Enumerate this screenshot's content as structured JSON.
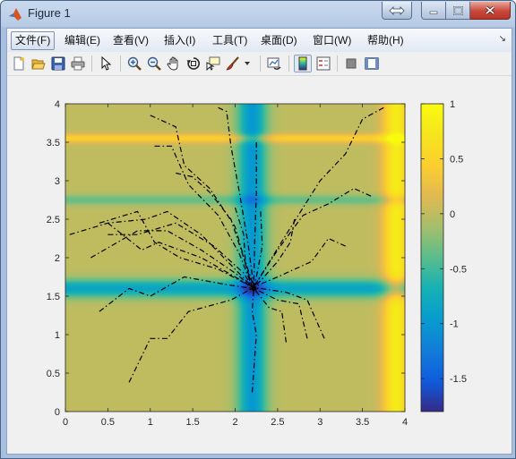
{
  "window": {
    "title": "Figure 1"
  },
  "menu": {
    "items": [
      "文件(F)",
      "编辑(E)",
      "查看(V)",
      "插入(I)",
      "工具(T)",
      "桌面(D)",
      "窗口(W)",
      "帮助(H)"
    ],
    "active_index": 0
  },
  "toolbar": {
    "icons": [
      "new-figure-icon",
      "open-file-icon",
      "save-icon",
      "print-icon",
      "edit-plot-arrow-icon",
      "zoom-in-icon",
      "zoom-out-icon",
      "pan-hand-icon",
      "rotate-3d-icon",
      "data-cursor-icon",
      "brush-icon",
      "link-plot-icon",
      "colorbar-icon",
      "legend-icon",
      "hide-plot-tools-icon",
      "show-plot-tools-icon"
    ]
  },
  "chart_data": {
    "type": "heatmap",
    "overlay": "dash-dot descent paths converging to a minimum",
    "xlim": [
      0,
      4
    ],
    "ylim": [
      0,
      4
    ],
    "x_ticks": [
      "0",
      "0.5",
      "1",
      "1.5",
      "2",
      "2.5",
      "3",
      "3.5",
      "4"
    ],
    "y_ticks": [
      "0",
      "0.5",
      "1",
      "1.5",
      "2",
      "2.5",
      "3",
      "3.5",
      "4"
    ],
    "colorbar": {
      "clim": [
        -1.8,
        1
      ],
      "ticks": [
        "1",
        "0.5",
        "0",
        "-0.5",
        "-1",
        "-1.5"
      ],
      "tick_values": [
        1,
        0.5,
        0,
        -0.5,
        -1,
        -1.5
      ],
      "colormap": "parula"
    },
    "field": {
      "background": 0,
      "vertical_bands": [
        {
          "x": 2.2,
          "width": 0.17,
          "amplitude": -1.0
        },
        {
          "x": 3.9,
          "width": 0.15,
          "amplitude": 0.8
        }
      ],
      "horizontal_bands": [
        {
          "y": 1.6,
          "width": 0.12,
          "amplitude": -0.85
        },
        {
          "y": 2.75,
          "width": 0.07,
          "amplitude": -0.35
        },
        {
          "y": 3.55,
          "width": 0.06,
          "amplitude": 0.45
        }
      ]
    },
    "minimum": {
      "x": 2.22,
      "y": 1.6
    },
    "paths": [
      [
        [
          0.05,
          2.3
        ],
        [
          0.5,
          2.45
        ],
        [
          0.95,
          2.5
        ],
        [
          1.2,
          2.6
        ],
        [
          1.6,
          2.3
        ],
        [
          2.0,
          1.85
        ],
        [
          2.2,
          1.62
        ]
      ],
      [
        [
          0.3,
          2.0
        ],
        [
          0.85,
          2.35
        ],
        [
          1.2,
          2.35
        ],
        [
          1.6,
          2.1
        ],
        [
          2.0,
          1.8
        ],
        [
          2.2,
          1.62
        ]
      ],
      [
        [
          0.4,
          2.45
        ],
        [
          0.85,
          2.6
        ],
        [
          1.05,
          2.2
        ],
        [
          1.35,
          2.0
        ],
        [
          1.8,
          1.85
        ],
        [
          2.2,
          1.62
        ]
      ],
      [
        [
          0.5,
          2.45
        ],
        [
          0.9,
          2.1
        ],
        [
          1.1,
          2.2
        ],
        [
          1.6,
          2.0
        ],
        [
          2.0,
          1.75
        ],
        [
          2.2,
          1.62
        ]
      ],
      [
        [
          0.5,
          2.3
        ],
        [
          0.85,
          2.3
        ],
        [
          1.3,
          2.45
        ],
        [
          1.75,
          2.15
        ],
        [
          2.1,
          1.8
        ],
        [
          2.2,
          1.62
        ]
      ],
      [
        [
          0.4,
          1.3
        ],
        [
          0.75,
          1.6
        ],
        [
          1.0,
          1.5
        ],
        [
          1.4,
          1.75
        ],
        [
          1.9,
          1.65
        ],
        [
          2.2,
          1.6
        ]
      ],
      [
        [
          0.75,
          0.38
        ],
        [
          1.0,
          0.95
        ],
        [
          1.2,
          0.95
        ],
        [
          1.45,
          1.3
        ],
        [
          1.95,
          1.45
        ],
        [
          2.2,
          1.6
        ]
      ],
      [
        [
          1.0,
          3.85
        ],
        [
          1.3,
          3.7
        ],
        [
          1.4,
          3.2
        ],
        [
          1.7,
          2.9
        ],
        [
          2.0,
          2.4
        ],
        [
          2.2,
          1.62
        ]
      ],
      [
        [
          1.05,
          3.45
        ],
        [
          1.25,
          3.45
        ],
        [
          1.45,
          2.95
        ],
        [
          1.8,
          2.55
        ],
        [
          2.05,
          2.05
        ],
        [
          2.2,
          1.62
        ]
      ],
      [
        [
          1.3,
          3.1
        ],
        [
          1.5,
          3.05
        ],
        [
          1.7,
          2.85
        ],
        [
          1.95,
          2.5
        ],
        [
          2.1,
          2.0
        ],
        [
          2.2,
          1.62
        ]
      ],
      [
        [
          1.8,
          3.95
        ],
        [
          1.9,
          3.9
        ],
        [
          1.95,
          3.45
        ],
        [
          2.05,
          2.85
        ],
        [
          2.15,
          2.2
        ],
        [
          2.22,
          1.62
        ]
      ],
      [
        [
          2.0,
          2.65
        ],
        [
          2.1,
          2.3
        ],
        [
          2.12,
          1.95
        ],
        [
          2.22,
          1.62
        ]
      ],
      [
        [
          2.25,
          3.5
        ],
        [
          2.25,
          2.85
        ],
        [
          2.23,
          2.2
        ],
        [
          2.22,
          1.62
        ]
      ],
      [
        [
          2.3,
          2.6
        ],
        [
          2.32,
          2.15
        ],
        [
          2.25,
          1.75
        ],
        [
          2.22,
          1.62
        ]
      ],
      [
        [
          2.7,
          2.5
        ],
        [
          2.65,
          2.2
        ],
        [
          2.5,
          1.95
        ],
        [
          2.3,
          1.7
        ],
        [
          2.22,
          1.62
        ]
      ],
      [
        [
          3.75,
          3.95
        ],
        [
          3.5,
          3.8
        ],
        [
          3.3,
          3.35
        ],
        [
          3.0,
          3.0
        ],
        [
          2.6,
          2.3
        ],
        [
          2.22,
          1.62
        ]
      ],
      [
        [
          3.6,
          2.8
        ],
        [
          3.4,
          2.9
        ],
        [
          3.1,
          2.7
        ],
        [
          2.8,
          2.55
        ],
        [
          2.5,
          2.1
        ],
        [
          2.22,
          1.62
        ]
      ],
      [
        [
          3.3,
          2.15
        ],
        [
          3.1,
          2.25
        ],
        [
          2.9,
          1.95
        ],
        [
          2.5,
          1.75
        ],
        [
          2.22,
          1.62
        ]
      ],
      [
        [
          3.05,
          0.95
        ],
        [
          2.85,
          1.45
        ],
        [
          2.6,
          1.55
        ],
        [
          2.3,
          1.6
        ],
        [
          2.22,
          1.6
        ]
      ],
      [
        [
          2.85,
          0.95
        ],
        [
          2.75,
          1.4
        ],
        [
          2.5,
          1.45
        ],
        [
          2.22,
          1.6
        ]
      ],
      [
        [
          2.6,
          0.9
        ],
        [
          2.55,
          1.3
        ],
        [
          2.4,
          1.35
        ],
        [
          2.22,
          1.6
        ]
      ],
      [
        [
          2.2,
          0.25
        ],
        [
          2.25,
          1.0
        ],
        [
          2.2,
          1.3
        ],
        [
          2.22,
          1.6
        ]
      ]
    ]
  }
}
